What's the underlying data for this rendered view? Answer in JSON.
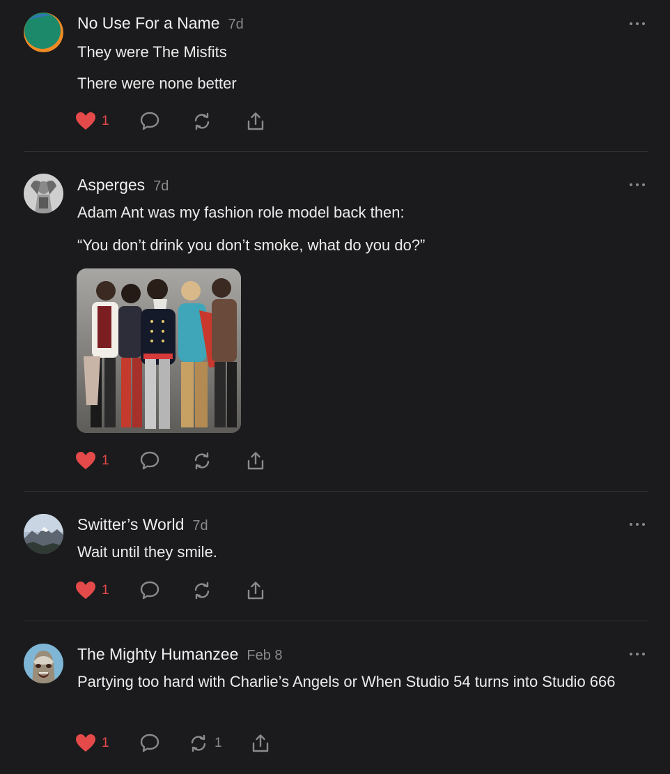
{
  "posts": [
    {
      "author": "No Use For a Name",
      "time": "7d",
      "paragraphs": [
        "They were The Misfits",
        "There were none better"
      ],
      "likes": "1",
      "restacks": ""
    },
    {
      "author": "Asperges",
      "time": "7d",
      "paragraphs": [
        "Adam Ant was my fashion role model back then:",
        "“You don’t drink you don’t smoke, what do you do?”"
      ],
      "likes": "1",
      "restacks": ""
    },
    {
      "author": "Switter’s World",
      "time": "7d",
      "paragraphs": [
        "Wait until they smile."
      ],
      "likes": "1",
      "restacks": ""
    },
    {
      "author": "The Mighty Humanzee",
      "time": "Feb 8",
      "paragraphs": [
        "Partying too hard with Charlie’s Angels or When Studio 54 turns into Studio 666"
      ],
      "likes": "1",
      "restacks": "1"
    }
  ],
  "colors": {
    "background": "#1b1b1d",
    "like_red": "#e54a4a",
    "muted": "#8a8a8d"
  },
  "icons": {
    "like": "heart-icon",
    "comment": "comment-bubble-icon",
    "restack": "restack-icon",
    "share": "share-icon",
    "more": "more-dots-icon"
  }
}
